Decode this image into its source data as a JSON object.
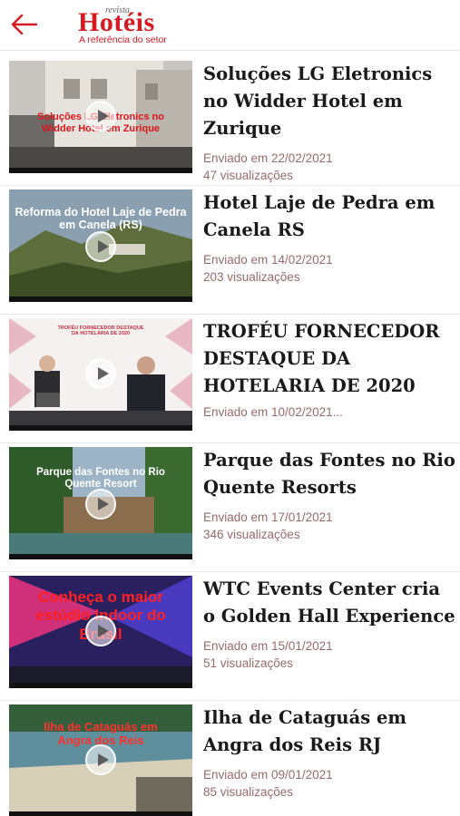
{
  "header": {
    "back_icon": "arrow-left-icon",
    "logo_small": "revista",
    "logo_brand": "Hotéis",
    "logo_tagline": "A referência do setor"
  },
  "colors": {
    "brand": "#d51a21",
    "meta": "#9a6a6a"
  },
  "videos": [
    {
      "title": "Soluções LG Eletronics no Widder Hotel em Zurique",
      "date": "Enviado em 22/02/2021",
      "views": "47 visualizações",
      "caption": "Soluções LG Eletronics no Widder Hotel em Zurique"
    },
    {
      "title": "Hotel Laje de Pedra em Canela RS",
      "date": "Enviado em 14/02/2021",
      "views": "203 visualizações",
      "caption": "Reforma do Hotel Laje de Pedra em Canela (RS)"
    },
    {
      "title": "TROFÉU FORNECEDOR DESTAQUE DA HOTELARIA DE 2020",
      "date": "Enviado em 10/02/2021...",
      "views": "",
      "caption": "TROFÉU FORNECEDOR DESTAQUE DA HOTELARIA DE 2020"
    },
    {
      "title": "Parque das Fontes no Rio Quente Resorts",
      "date": "Enviado em 17/01/2021",
      "views": "346 visualizações",
      "caption": "Parque das Fontes no Rio Quente Resort"
    },
    {
      "title": "WTC Events Center cria o Golden Hall Experience",
      "date": "Enviado em 15/01/2021",
      "views": "51 visualizações",
      "caption": "Conheça o maior estúdio indoor do Brasil"
    },
    {
      "title": "Ilha de Cataguás em Angra dos Reis RJ",
      "date": "Enviado em 09/01/2021",
      "views": "85 visualizações",
      "caption": "Ilha de Cataguás em Angra dos Reis"
    }
  ]
}
